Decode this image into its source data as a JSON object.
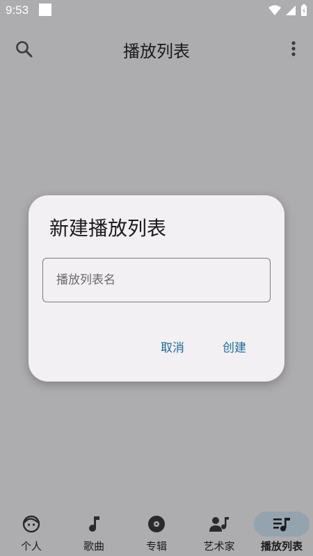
{
  "status_bar": {
    "time": "9:53"
  },
  "app_bar": {
    "title": "播放列表",
    "search_icon": "search-icon",
    "more_icon": "more-vert-icon"
  },
  "dialog": {
    "title": "新建播放列表",
    "input": {
      "placeholder": "播放列表名",
      "value": ""
    },
    "cancel_label": "取消",
    "create_label": "创建",
    "accent_color": "#1e6a99"
  },
  "bottom_nav": {
    "items": [
      {
        "label": "个人",
        "icon": "face-icon",
        "active": false
      },
      {
        "label": "歌曲",
        "icon": "music-note-icon",
        "active": false
      },
      {
        "label": "专辑",
        "icon": "album-icon",
        "active": false
      },
      {
        "label": "艺术家",
        "icon": "artist-icon",
        "active": false
      },
      {
        "label": "播放列表",
        "icon": "queue-music-icon",
        "active": true
      }
    ]
  }
}
